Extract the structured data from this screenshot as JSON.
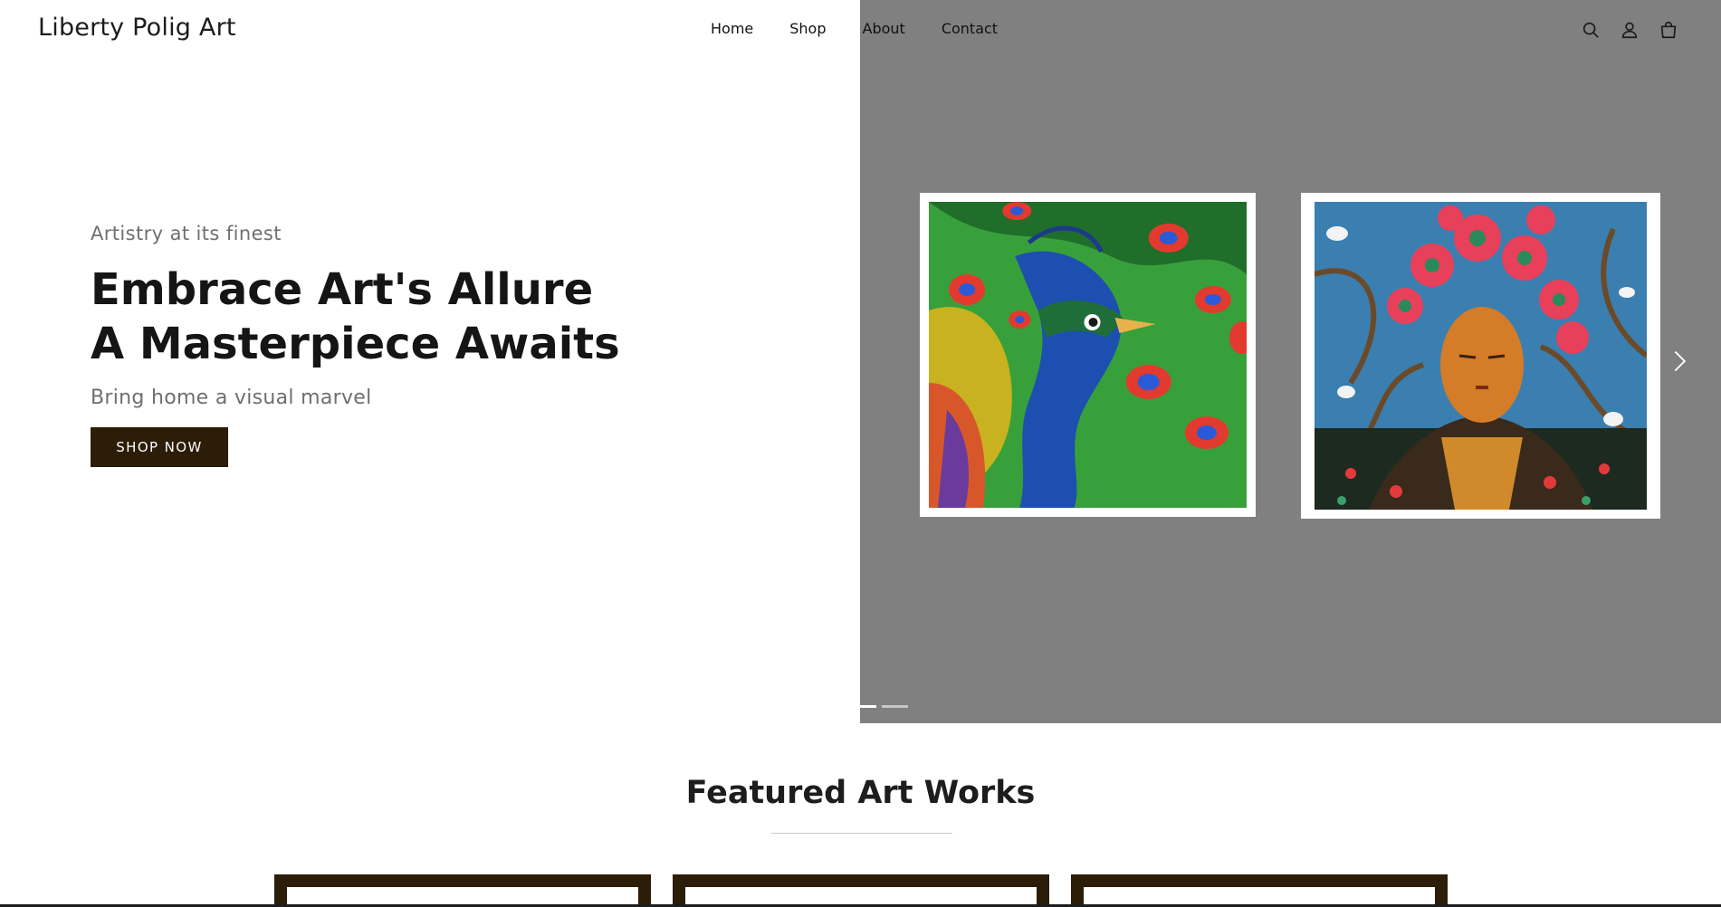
{
  "header": {
    "logo": "Liberty Polig Art",
    "nav": [
      "Home",
      "Shop",
      "About",
      "Contact"
    ],
    "icons": [
      "search-icon",
      "account-icon",
      "cart-icon"
    ]
  },
  "hero": {
    "kicker": "Artistry at its finest",
    "heading_line1": "Embrace Art's Allure",
    "heading_line2": "A Masterpiece Awaits",
    "subheading": "Bring home a visual marvel",
    "button_label": "SHOP NOW",
    "artworks": [
      "peacock painting",
      "woman with red flowers painting"
    ],
    "slides_total": 2,
    "slide_active": 1,
    "arrow_icon": "chevron-right-icon"
  },
  "featured": {
    "title": "Featured Art Works"
  },
  "colors": {
    "accent": "#2b1d08",
    "panel_gray": "#808080"
  }
}
